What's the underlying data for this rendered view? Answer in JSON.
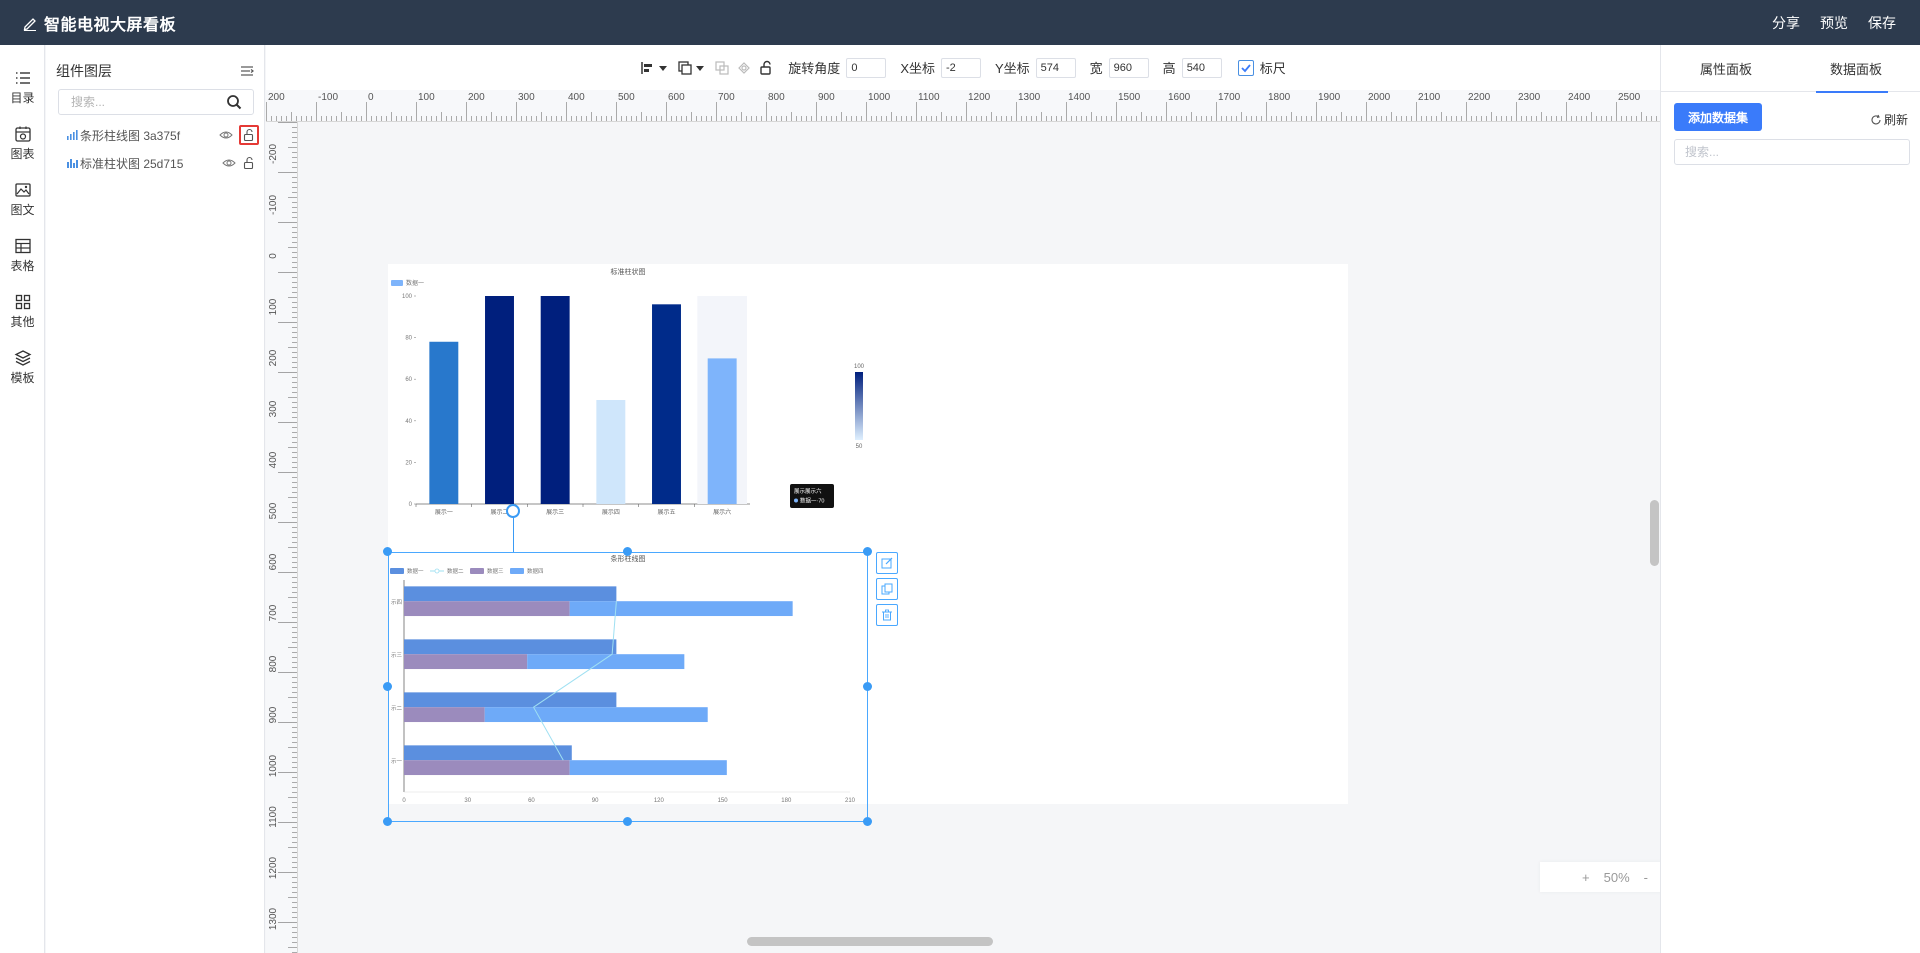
{
  "header": {
    "title": "智能电视大屏看板",
    "actions": {
      "share": "分享",
      "preview": "预览",
      "save": "保存"
    }
  },
  "leftnav": {
    "items": [
      {
        "label": "目录",
        "icon": "list-icon"
      },
      {
        "label": "图表",
        "icon": "chart-icon"
      },
      {
        "label": "图文",
        "icon": "image-text-icon"
      },
      {
        "label": "表格",
        "icon": "table-icon"
      },
      {
        "label": "其他",
        "icon": "grid-icon"
      },
      {
        "label": "模板",
        "icon": "template-icon"
      }
    ]
  },
  "layers": {
    "title": "组件图层",
    "search_placeholder": "搜索...",
    "items": [
      {
        "name": "条形柱线图 3a375f",
        "locked_highlight": true
      },
      {
        "name": "标准柱状图 25d715",
        "locked_highlight": false
      }
    ]
  },
  "toolbar": {
    "rotate_label": "旋转角度",
    "rotate_value": "0",
    "x_label": "X坐标",
    "x_value": "-2",
    "y_label": "Y坐标",
    "y_value": "574",
    "w_label": "宽",
    "w_value": "960",
    "h_label": "高",
    "h_value": "540",
    "ruler_label": "标尺",
    "ruler_checked": true
  },
  "rulers": {
    "h_labels": [
      "200",
      "-100",
      "0",
      "100",
      "200",
      "300",
      "400",
      "500",
      "600",
      "700",
      "800",
      "900",
      "1000",
      "1100",
      "1200",
      "1300",
      "1400",
      "1500",
      "1600",
      "1700",
      "1800",
      "1900",
      "2000",
      "2100",
      "2200",
      "2300",
      "2400",
      "2500"
    ],
    "v_labels": [
      "-200",
      "-100",
      "0",
      "100",
      "200",
      "300",
      "400",
      "500",
      "600",
      "700",
      "800",
      "900",
      "1000",
      "1100",
      "1200",
      "1300"
    ]
  },
  "zoom": {
    "plus": "+",
    "value": "50%",
    "minus": "-"
  },
  "rightpanel": {
    "tabs": [
      "属性面板",
      "数据面板"
    ],
    "active_tab": 1,
    "add_dataset": "添加数据集",
    "refresh": "刷新",
    "search_placeholder": "搜索..."
  },
  "colors": {
    "header_bg": "#2d3b4e",
    "accent": "#3a7bfa",
    "selection": "#3a9bf5"
  },
  "chart_data": [
    {
      "type": "bar",
      "title": "标准柱状图",
      "legend": [
        "数据一"
      ],
      "categories": [
        "展示一",
        "展示二",
        "展示三",
        "展示四",
        "展示五",
        "展示六"
      ],
      "values": [
        78,
        100,
        100,
        50,
        96,
        70
      ],
      "colors": [
        "#2878cc",
        "#001f7d",
        "#001f7d",
        "#cfe6fb",
        "#002b8a",
        "#7eb4fb"
      ],
      "y_ticks": [
        "0",
        "20",
        "40",
        "60",
        "80",
        "100"
      ],
      "ylim": [
        0,
        100
      ],
      "visual_map": {
        "max": "100",
        "min": "50"
      },
      "tooltip": {
        "title": "展示展示六",
        "series": "数据一",
        "value": "70"
      }
    },
    {
      "type": "bar",
      "orientation": "horizontal",
      "title": "条形柱线图",
      "legend": [
        "数据一",
        "数据二",
        "数据三",
        "数据四"
      ],
      "categories": [
        "展示一",
        "展示二",
        "展示三",
        "展示四"
      ],
      "category_labels": [
        "示一",
        "示二",
        "示三",
        "示四"
      ],
      "series": [
        {
          "name": "数据一",
          "values": [
            79,
            100,
            100,
            100
          ],
          "color": "#5b8fdf"
        },
        {
          "name": "数据二",
          "kind": "line",
          "values": [
            75,
            61,
            98,
            100
          ],
          "color": "#9fe0f2"
        },
        {
          "name": "数据三",
          "values": [
            78,
            38,
            58,
            78
          ],
          "color": "#9b8bbd"
        },
        {
          "name": "数据四",
          "stack": "数据三",
          "values": [
            74,
            105,
            74,
            105
          ],
          "color": "#6eaaf8"
        }
      ],
      "x_ticks": [
        "0",
        "30",
        "60",
        "90",
        "120",
        "150",
        "180",
        "210"
      ],
      "xlim": [
        0,
        210
      ]
    }
  ]
}
